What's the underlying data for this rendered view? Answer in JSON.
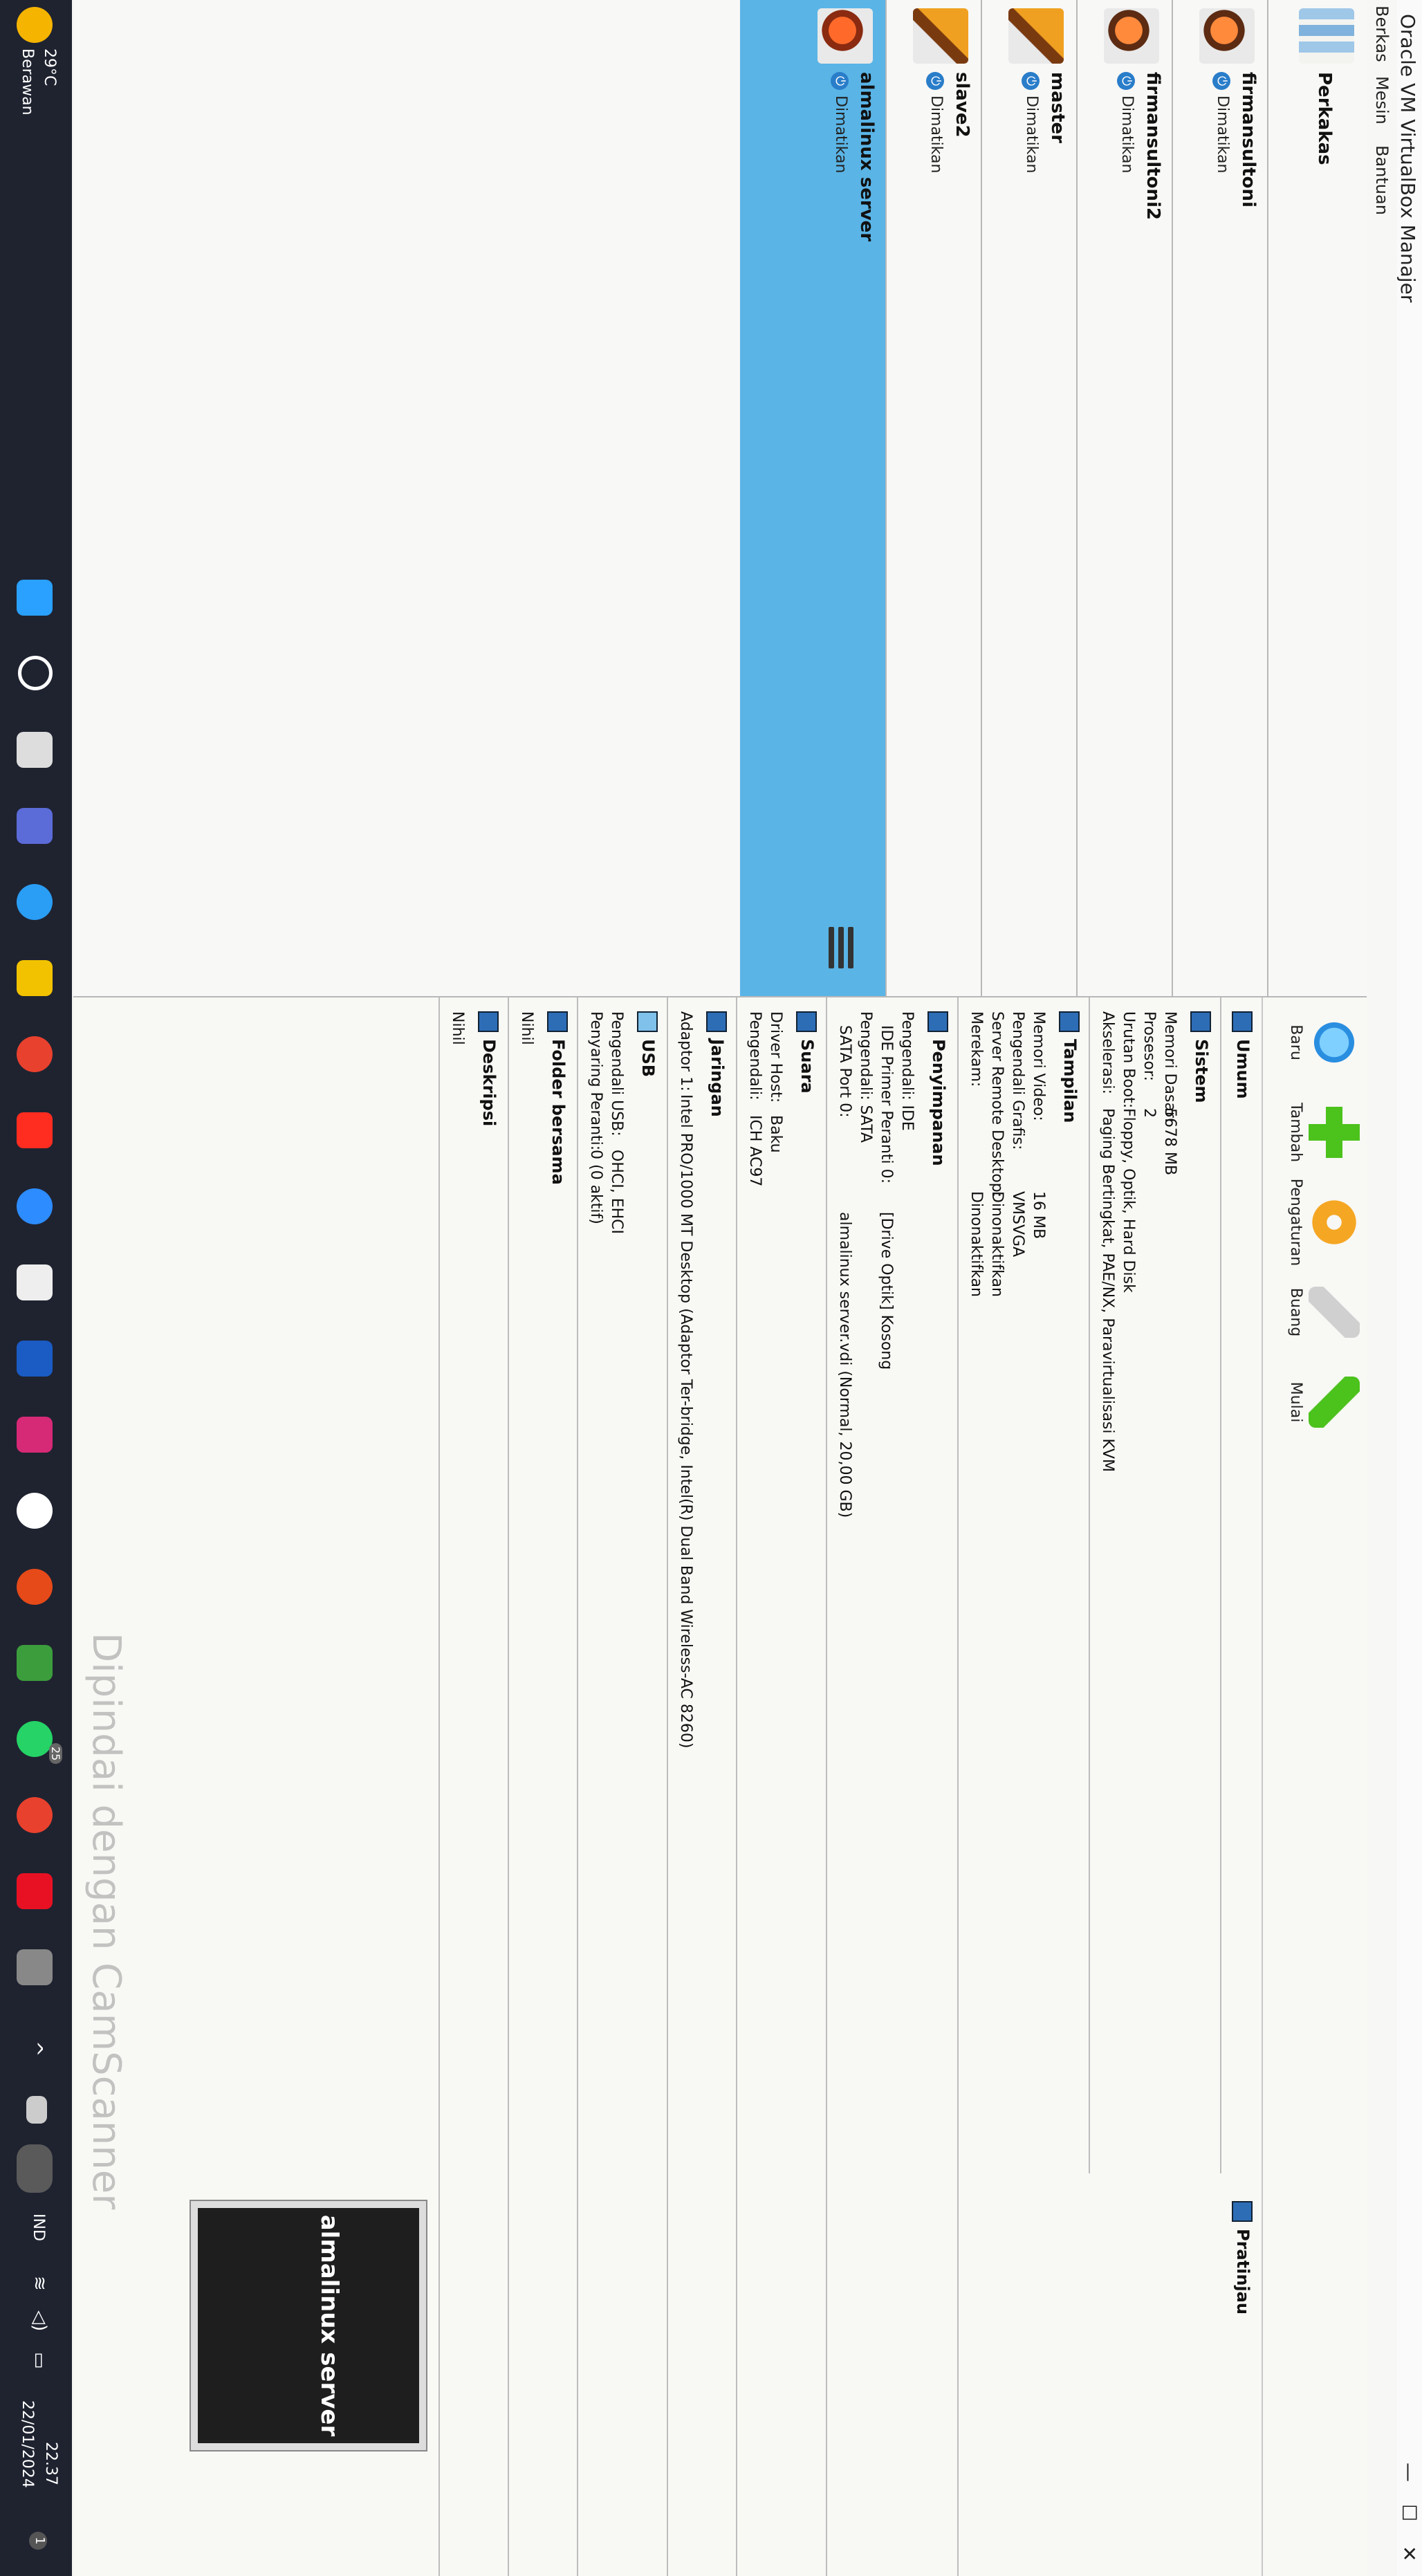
{
  "window": {
    "title": "Oracle VM VirtualBox Manajer",
    "menu": [
      "Berkas",
      "Mesin",
      "Bantuan"
    ]
  },
  "tools": {
    "label": "Perkakas"
  },
  "vms": [
    {
      "name": "firmansultoni",
      "state": "Dimatikan"
    },
    {
      "name": "firmansultoni2",
      "state": "Dimatikan"
    },
    {
      "name": "master",
      "state": "Dimatikan"
    },
    {
      "name": "slave2",
      "state": "Dimatikan"
    },
    {
      "name": "almalinux server",
      "state": "Dimatikan"
    }
  ],
  "toolbar": {
    "new": "Baru",
    "add": "Tambah",
    "settings": "Pengaturan",
    "discard": "Buang",
    "start": "Mulai"
  },
  "details": {
    "general": {
      "title": "Umum"
    },
    "system": {
      "title": "Sistem",
      "rows": [
        {
          "k": "Memori Dasar:",
          "v": "5678 MB"
        },
        {
          "k": "Prosesor:",
          "v": "2"
        },
        {
          "k": "Urutan Boot:",
          "v": "Floppy, Optik, Hard Disk"
        },
        {
          "k": "Akselerasi:",
          "v": "Paging Bertingkat, PAE/NX, Paravirtualisasi KVM"
        }
      ]
    },
    "display": {
      "title": "Tampilan",
      "rows": [
        {
          "k": "Memori Video:",
          "v": "16 MB"
        },
        {
          "k": "Pengendali Grafis:",
          "v": "VMSVGA"
        },
        {
          "k": "Server Remote Desktop:",
          "v": "Dinonaktifkan"
        },
        {
          "k": "Merekam:",
          "v": "Dinonaktifkan"
        }
      ]
    },
    "storage": {
      "title": "Penyimpanan",
      "rows": [
        {
          "k": "Pengendali: IDE",
          "v": ""
        },
        {
          "k": "IDE Primer Peranti 0:",
          "v": "[Drive Optik] Kosong"
        },
        {
          "k": "Pengendali: SATA",
          "v": ""
        },
        {
          "k": "SATA Port 0:",
          "v": "almalinux server.vdi (Normal, 20,00 GB)"
        }
      ]
    },
    "audio": {
      "title": "Suara",
      "rows": [
        {
          "k": "Driver Host:",
          "v": "Baku"
        },
        {
          "k": "Pengendali:",
          "v": "ICH AC97"
        }
      ]
    },
    "network": {
      "title": "Jaringan",
      "rows": [
        {
          "k": "Adaptor 1:",
          "v": "Intel PRO/1000 MT Desktop (Adaptor Ter-bridge, Intel(R) Dual Band Wireless-AC 8260)"
        }
      ]
    },
    "usb": {
      "title": "USB",
      "rows": [
        {
          "k": "Pengendali USB:",
          "v": "OHCI, EHCI"
        },
        {
          "k": "Penyaring Peranti:",
          "v": "0 (0 aktif)"
        }
      ]
    },
    "shared": {
      "title": "Folder bersama",
      "value": "Nihil"
    },
    "description": {
      "title": "Deskripsi",
      "value": "Nihil"
    },
    "preview": {
      "title": "Pratinjau",
      "text": "almalinux server"
    }
  },
  "taskbar": {
    "weather_temp": "29°C",
    "weather_desc": "Berawan",
    "lang": "IND",
    "time": "22.37",
    "date": "22/01/2024",
    "badge": "25",
    "notif": "1"
  },
  "watermark": "Dipindai dengan CamScanner",
  "colors": {
    "selected": "#5ab4e6",
    "taskbar": "#1f2330"
  }
}
